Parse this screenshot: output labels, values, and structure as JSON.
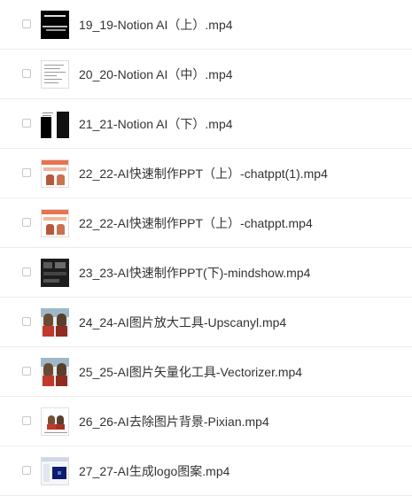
{
  "files": [
    {
      "name": "19_19-Notion AI（上）.mp4",
      "thumb": "video-thumbnail-notion-dark"
    },
    {
      "name": "20_20-Notion AI（中）.mp4",
      "thumb": "video-thumbnail-notion-doc"
    },
    {
      "name": "21_21-Notion AI（下）.mp4",
      "thumb": "video-thumbnail-notion-split"
    },
    {
      "name": "22_22-AI快速制作PPT（上）-chatppt(1).mp4",
      "thumb": "video-thumbnail-chatppt"
    },
    {
      "name": "22_22-AI快速制作PPT（上）-chatppt.mp4",
      "thumb": "video-thumbnail-chatppt"
    },
    {
      "name": "23_23-AI快速制作PPT(下)-mindshow.mp4",
      "thumb": "video-thumbnail-mindshow"
    },
    {
      "name": "24_24-AI图片放大工具-Upscanyl.mp4",
      "thumb": "video-thumbnail-people"
    },
    {
      "name": "25_25-AI图片矢量化工具-Vectorizer.mp4",
      "thumb": "video-thumbnail-people"
    },
    {
      "name": "26_26-AI去除图片背景-Pixian.mp4",
      "thumb": "video-thumbnail-pixian"
    },
    {
      "name": "27_27-AI生成logo图案.mp4",
      "thumb": "video-thumbnail-logo"
    }
  ]
}
